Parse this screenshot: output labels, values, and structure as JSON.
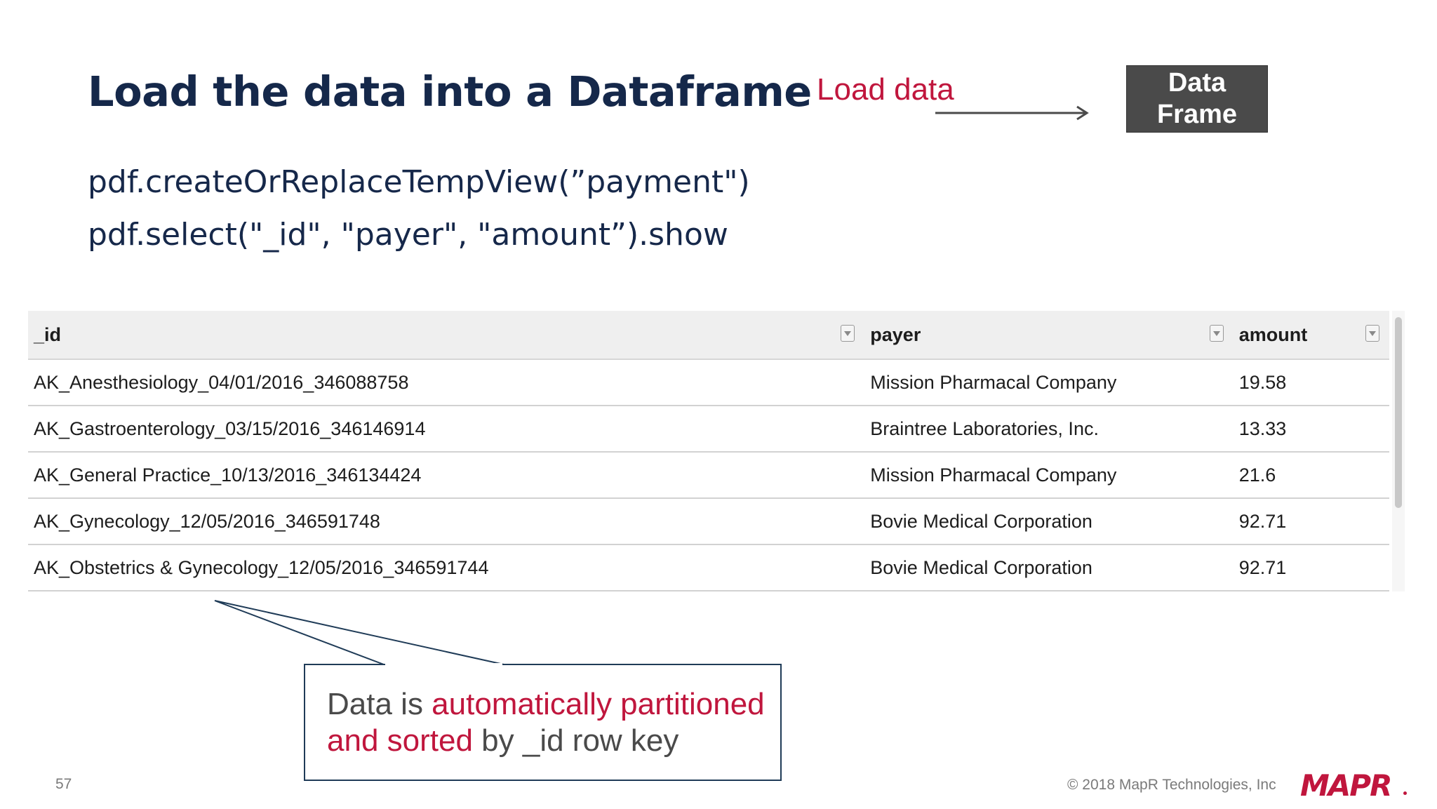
{
  "slide": {
    "title": "Load the data into a Dataframe",
    "code_lines": [
      "pdf.createOrReplaceTempView(”payment\")",
      "pdf.select(\"_id\", \"payer\", \"amount”).show"
    ],
    "diagram": {
      "load_label": "Load data",
      "box_line1": "Data",
      "box_line2": "Frame"
    },
    "table": {
      "headers": [
        "_id",
        "payer",
        "amount"
      ],
      "rows": [
        [
          "AK_Anesthesiology_04/01/2016_346088758",
          "Mission Pharmacal Company",
          "19.58"
        ],
        [
          "AK_Gastroenterology_03/15/2016_346146914",
          "Braintree Laboratories, Inc.",
          "13.33"
        ],
        [
          "AK_General Practice_10/13/2016_346134424",
          "Mission Pharmacal Company",
          "21.6"
        ],
        [
          "AK_Gynecology_12/05/2016_346591748",
          "Bovie Medical Corporation",
          "92.71"
        ],
        [
          "AK_Obstetrics & Gynecology_12/05/2016_346591744",
          "Bovie Medical Corporation",
          "92.71"
        ]
      ]
    },
    "callout": {
      "part1": "Data is ",
      "part2": "automatically partitioned",
      "part3": "and sorted",
      "part4": " by _id  row key"
    },
    "page_number": "57",
    "copyright": "© 2018 MapR Technologies, Inc",
    "logo_text": "MAPR",
    "colors": {
      "title": "#15284a",
      "accent_red": "#c0163d",
      "box_dark": "#4a4a4a",
      "callout_border": "#1f3b57"
    }
  }
}
